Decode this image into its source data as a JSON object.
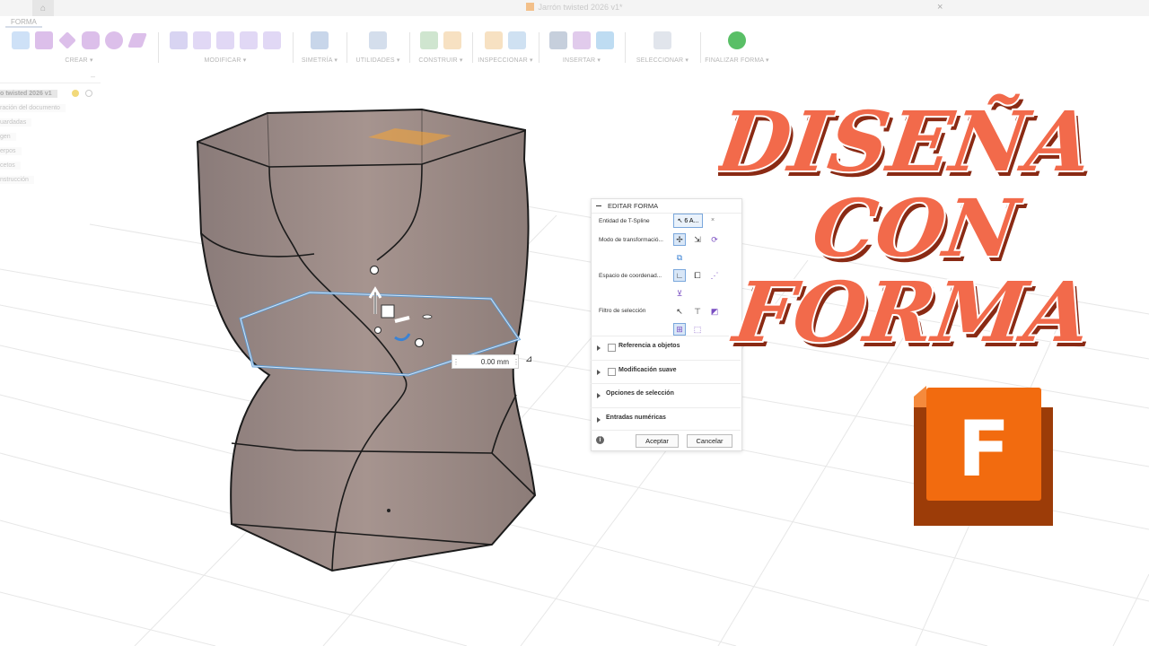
{
  "titlebar": {
    "doc_title": "Jarrón twisted 2026 v1*",
    "close_glyph": "×",
    "home_icon": "home-icon"
  },
  "ribbon": {
    "active_tab": "FORMA",
    "groups": [
      {
        "label": "CREAR ▾"
      },
      {
        "label": "MODIFICAR ▾"
      },
      {
        "label": "SIMETRÍA ▾"
      },
      {
        "label": "UTILIDADES ▾"
      },
      {
        "label": "CONSTRUIR ▾"
      },
      {
        "label": "INSPECCIONAR ▾"
      },
      {
        "label": "INSERTAR ▾"
      },
      {
        "label": "SELECCIONAR ▾"
      },
      {
        "label": "FINALIZAR FORMA ▾"
      }
    ]
  },
  "browser": {
    "collapse": "–",
    "items": [
      {
        "label": "o twisted 2026 v1"
      },
      {
        "label": "ración del documento"
      },
      {
        "label": "uardadas"
      },
      {
        "label": "gen"
      },
      {
        "label": "erpos"
      },
      {
        "label": "cetos"
      },
      {
        "label": "nstrucción"
      }
    ]
  },
  "dimension": {
    "value": "0.00 mm",
    "dots": "⋮"
  },
  "panel": {
    "title": "EDITAR FORMA",
    "entity_label": "Entidad de T-Spline",
    "entity_value": "6 A...",
    "entity_clear": "×",
    "transform_mode_label": "Modo de transformació...",
    "coord_space_label": "Espacio de coordenad...",
    "filter_label": "Filtro de selección",
    "sections": [
      {
        "label": "Referencia a objetos",
        "checkbox": true
      },
      {
        "label": "Modificación suave",
        "checkbox": true
      },
      {
        "label": "Opciones de selección",
        "checkbox": false
      },
      {
        "label": "Entradas numéricas",
        "checkbox": false
      }
    ],
    "info": "i",
    "ok_label": "Aceptar",
    "cancel_label": "Cancelar"
  },
  "promo": {
    "line1": "DISEÑA",
    "line2": "CON",
    "line3": "FORMA",
    "color": "#f26a4b"
  },
  "logo": {
    "letter": "F",
    "color_main": "#f26b0f",
    "color_dark": "#9c3c08"
  },
  "colors": {
    "vase": "#9a8a87",
    "selection": "#5b9bd5",
    "face_highlight": "#f2a43a"
  }
}
